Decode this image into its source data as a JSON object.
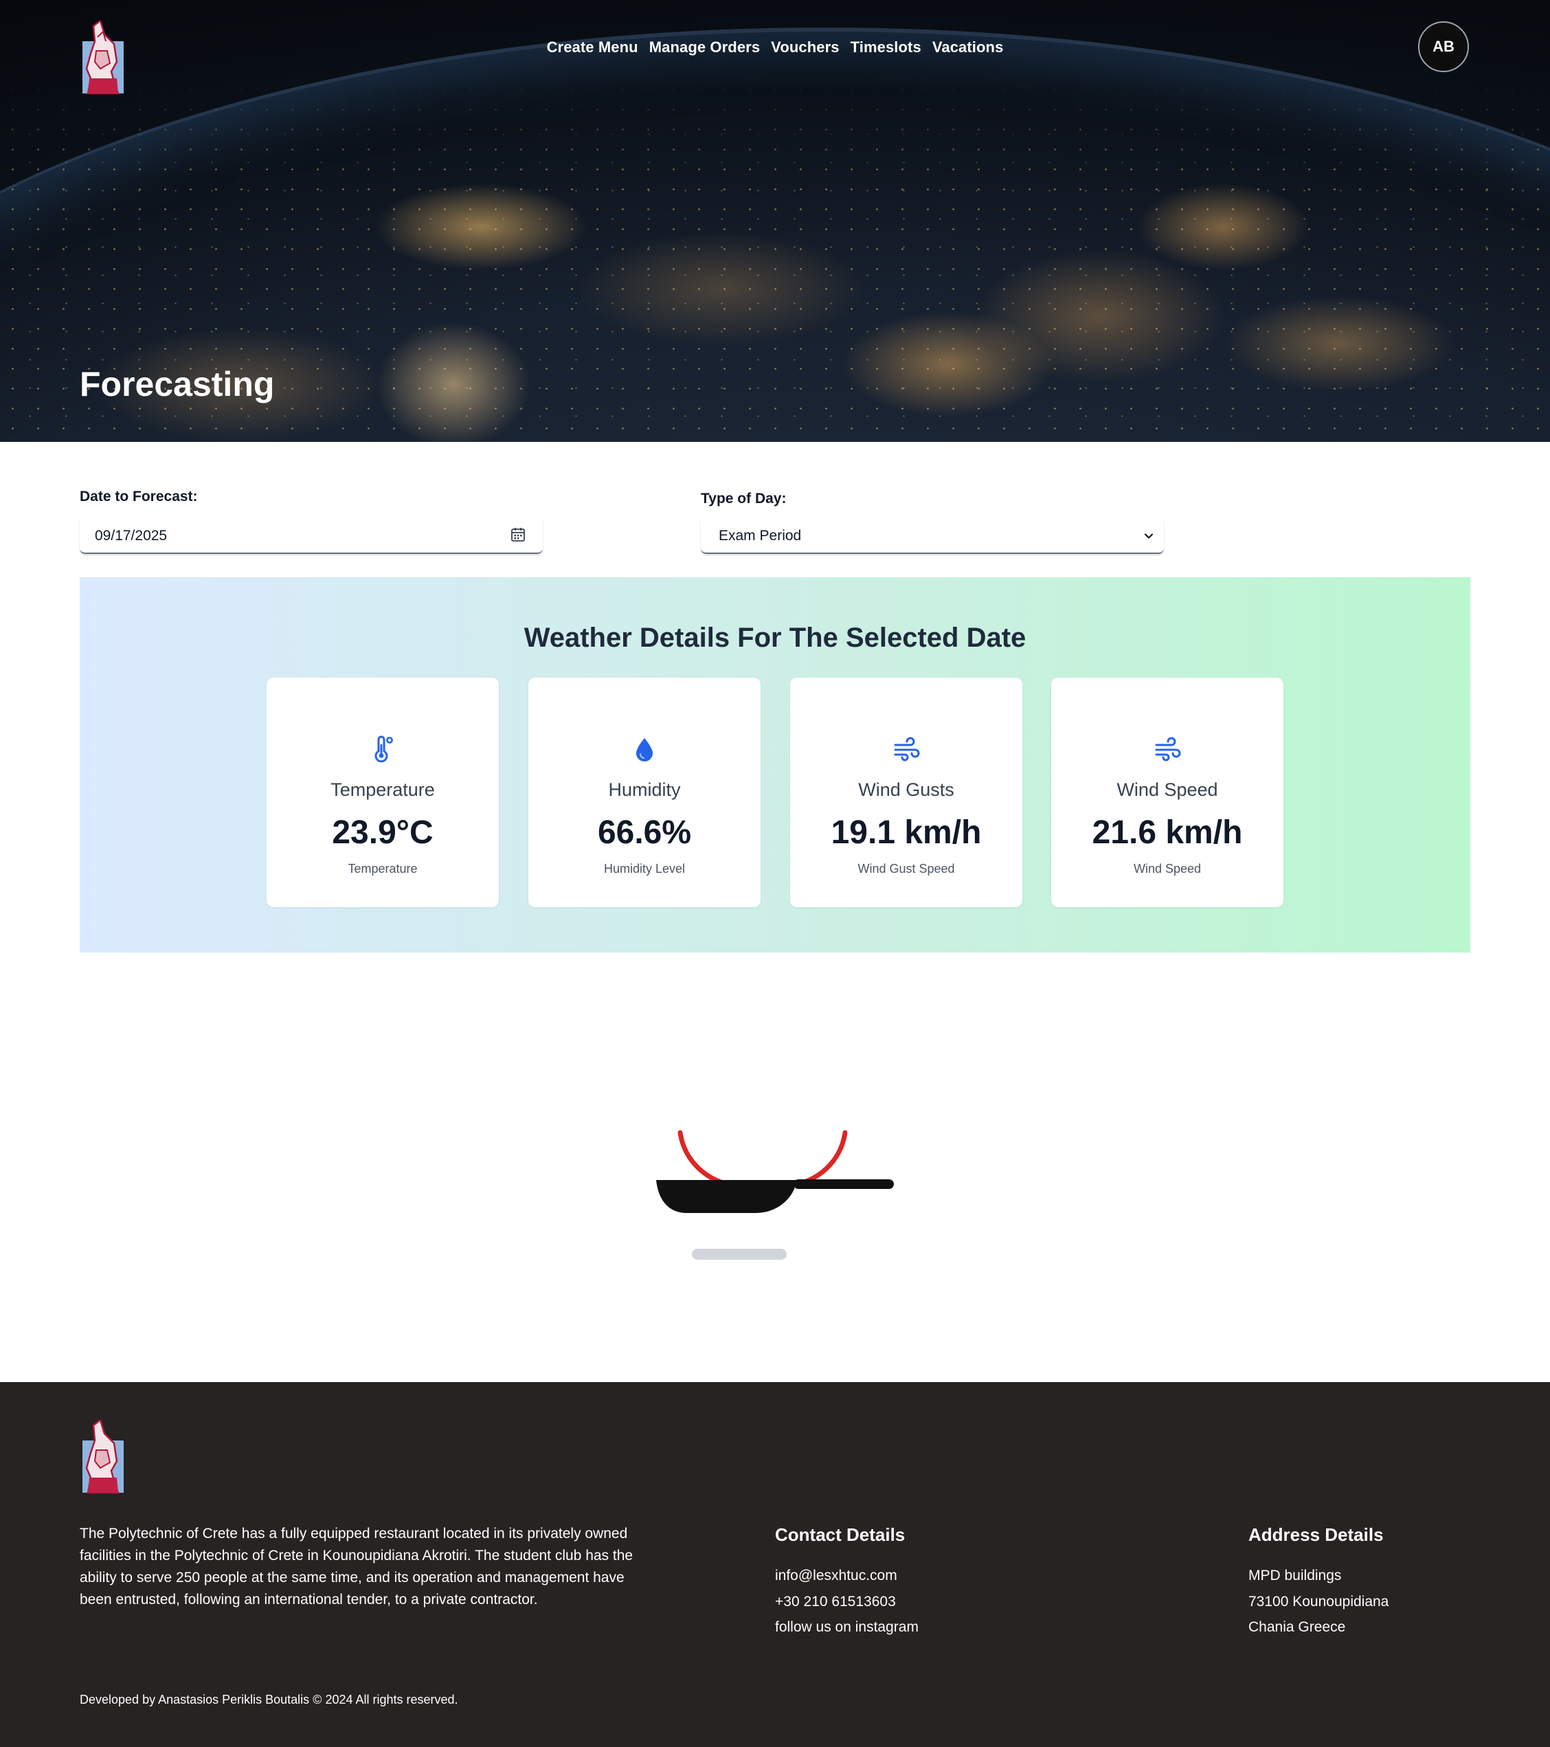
{
  "nav": {
    "items": [
      "Create Menu",
      "Manage Orders",
      "Vouchers",
      "Timeslots",
      "Vacations"
    ],
    "avatar_initials": "AB"
  },
  "hero": {
    "title": "Forecasting"
  },
  "form": {
    "date_label": "Date to Forecast:",
    "date_value": "09/17/2025",
    "day_type_label": "Type of Day:",
    "day_type_value": "Exam Period"
  },
  "weather": {
    "title": "Weather Details For The Selected Date",
    "cards": [
      {
        "icon": "thermometer-icon",
        "title": "Temperature",
        "value": "23.9°C",
        "sub": "Temperature"
      },
      {
        "icon": "droplet-icon",
        "title": "Humidity",
        "value": "66.6%",
        "sub": "Humidity Level"
      },
      {
        "icon": "wind-icon",
        "title": "Wind Gusts",
        "value": "19.1 km/h",
        "sub": "Wind Gust Speed"
      },
      {
        "icon": "wind-icon",
        "title": "Wind Speed",
        "value": "21.6 km/h",
        "sub": "Wind Speed"
      }
    ],
    "icon_color": "#2563eb"
  },
  "footer": {
    "about": "The Polytechnic of Crete has a fully equipped restaurant located in its privately owned facilities in the Polytechnic of Crete in Kounoupidiana Akrotiri. The student club has the ability to serve 250 people at the same time, and its operation and management have been entrusted, following an international tender, to a private contractor.",
    "contact_title": "Contact Details",
    "contact": [
      "info@lesxhtuc.com",
      "+30 210 61513603",
      "follow us on instagram"
    ],
    "address_title": "Address Details",
    "address": [
      "MPD buildings",
      "73100 Kounoupidiana",
      "Chania Greece"
    ],
    "copyright": "Developed by Anastasios Periklis Boutalis © 2024 All rights reserved."
  },
  "colors": {
    "footer_bg": "#272322",
    "accent_blue": "#2563eb",
    "pan_red": "#dc2626"
  }
}
